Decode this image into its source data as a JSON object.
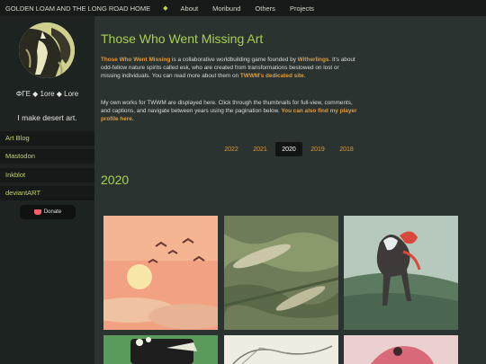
{
  "topnav": {
    "site_title": "GOLDEN LOAM AND THE LONG ROAD HOME",
    "diamond": "◆",
    "links": [
      "About",
      "Moribund",
      "Others",
      "Projects"
    ]
  },
  "sidebar": {
    "handle": "ΦΓΕ ◆ 1ore ◆ Lore",
    "tagline": "I make desert art.",
    "links": [
      "Art Blog",
      "Mastodon",
      "Inkblot",
      "deviantART"
    ],
    "donate_label": "Donate"
  },
  "main": {
    "title": "Those Who Went Missing Art",
    "intro": {
      "game_name": "Those Who Went Missing",
      "t1": " is a collaborative worldbuilding game founded by ",
      "founder": "Witherlings",
      "t2": ". It's about odd-fellow nature spirits called esk, who are created from transformations bestowed on lost or missing individuals. You can read more about them on ",
      "site_link": "TWWM's dedicated site",
      "t3": "."
    },
    "works": {
      "text": "My own works for TWWM are displayed here. Click through the thumbnails for full-view, comments, and captions, and navigate between years using the pagination below. ",
      "profile_link": "You can also find my player profile here."
    },
    "pagination": [
      "2022",
      "2021",
      "2020",
      "2019",
      "2018"
    ],
    "active_year": "2020",
    "year_heading": "2020"
  },
  "colors": {
    "accent_green": "#a9d24b",
    "accent_orange": "#e09a3c",
    "background": "#2a3330",
    "sidebar": "#1c2321"
  }
}
